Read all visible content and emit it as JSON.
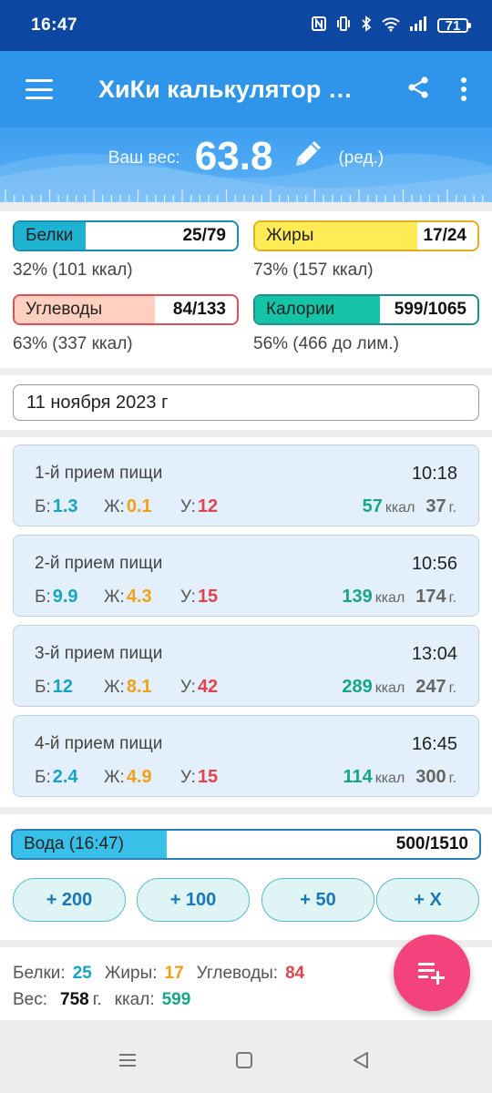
{
  "status": {
    "time": "16:47",
    "battery": "71"
  },
  "toolbar": {
    "title": "ХиКи калькулятор калорий"
  },
  "weight": {
    "label": "Ваш вес:",
    "value": "63.8",
    "edit": "(ред.)"
  },
  "macros": [
    {
      "name": "Белки",
      "value": "25/79",
      "pct": "32% (101 ккал)",
      "fill": 0.32,
      "color": "#1fb3d2",
      "border": "#1b8db0"
    },
    {
      "name": "Жиры",
      "value": "17/24",
      "pct": "73% (157 ккал)",
      "fill": 0.73,
      "color": "#ffeb55",
      "border": "#e0b020"
    },
    {
      "name": "Углеводы",
      "value": "84/133",
      "pct": "63% (337 ккал)",
      "fill": 0.63,
      "color": "#ffcfc0",
      "border": "#d9515a"
    },
    {
      "name": "Калории",
      "value": "599/1065",
      "pct": "56% (466 до лим.)",
      "fill": 0.56,
      "color": "#15c4a6",
      "border": "#1b8f88"
    }
  ],
  "date": "11 ноября 2023 г",
  "meal_labels": {
    "b": "Б:",
    "z": "Ж:",
    "u": "У:",
    "kcal": "ккал",
    "gram": "г."
  },
  "meals": [
    {
      "name": "1-й прием пищи",
      "time": "10:18",
      "b": "1.3",
      "z": "0.1",
      "u": "12",
      "kcal": "57",
      "g": "37"
    },
    {
      "name": "2-й прием пищи",
      "time": "10:56",
      "b": "9.9",
      "z": "4.3",
      "u": "15",
      "kcal": "139",
      "g": "174"
    },
    {
      "name": "3-й прием пищи",
      "time": "13:04",
      "b": "12",
      "z": "8.1",
      "u": "42",
      "kcal": "289",
      "g": "247"
    },
    {
      "name": "4-й прием пищи",
      "time": "16:45",
      "b": "2.4",
      "z": "4.9",
      "u": "15",
      "kcal": "114",
      "g": "300"
    }
  ],
  "water": {
    "label": "Вода (16:47)",
    "value": "500/1510",
    "fill": 0.331,
    "buttons": [
      "+ 200",
      "+ 100",
      "+ 50",
      "+ X"
    ]
  },
  "summary": {
    "b_label": "Белки:",
    "b": "25",
    "z_label": "Жиры:",
    "z": "17",
    "u_label": "Углеводы:",
    "u": "84",
    "w_label": "Вес:",
    "w": "758",
    "w_unit": "г.",
    "k_label": "ккал:",
    "k": "599"
  },
  "colors": {
    "protein": "#18a3c2",
    "fat": "#f0a01b",
    "carb": "#e0434f",
    "kcal": "#16a589",
    "fab": "#f4427c"
  },
  "icons": [
    "menu-icon",
    "share-icon",
    "more-vert-icon",
    "pencil-icon",
    "playlist-add-icon",
    "nav-menu-icon",
    "nav-home-icon",
    "nav-back-icon"
  ]
}
